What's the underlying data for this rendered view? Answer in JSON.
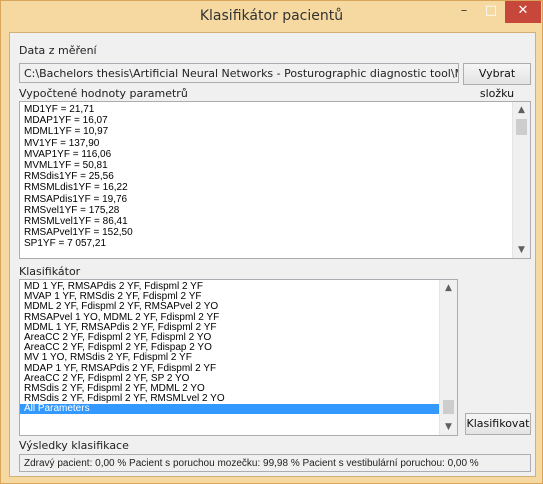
{
  "window": {
    "title": "Klasifikátor pacientů",
    "minimize": "–",
    "maximize": "□",
    "close": "✕"
  },
  "measurement": {
    "label": "Data z měření",
    "path": "C:\\Bachelors thesis\\Artificial Neural Networks - Posturographic diagnostic tool\\Measurements\\Bene",
    "browse_button": "Vybrat složku"
  },
  "parameters": {
    "label": "Vypočtené hodnoty parametrů",
    "lines": [
      "MD1YF = 21,71",
      "MDAP1YF = 16,07",
      "MDML1YF = 10,97",
      "MV1YF = 137,90",
      "MVAP1YF = 116,06",
      "MVML1YF = 50,81",
      "RMSdis1YF = 25,56",
      "RMSMLdis1YF = 16,22",
      "RMSAPdis1YF = 19,76",
      "RMSvel1YF = 175,28",
      "RMSMLvel1YF = 86,41",
      "RMSAPvel1YF = 152,50",
      "SP1YF = 7 057,21"
    ]
  },
  "classifier": {
    "label": "Klasifikátor",
    "items": [
      "MD 1 YF, RMSAPdis 2 YF, Fdispml 2 YF",
      "MVAP 1 YF, RMSdis 2 YF, Fdispml 2 YF",
      "MDML 2 YF, Fdispml 2 YF, RMSAPvel 2 YO",
      "RMSAPvel 1 YO, MDML 2 YF, Fdispml 2 YF",
      "MDML 1 YF, RMSAPdis 2 YF, Fdispml 2 YF",
      "AreaCC 2 YF, Fdispml 2 YF, Fdispml 2 YO",
      "AreaCC 2 YF, Fdispml 2 YF, Fdispap 2 YO",
      "MV 1 YO, RMSdis 2 YF, Fdispml 2 YF",
      "MDAP 1 YF, RMSAPdis 2 YF, Fdispml 2 YF",
      "AreaCC 2 YF, Fdispml 2 YF, SP 2 YO",
      "RMSdis 2 YF, Fdispml 2 YF, MDML 2 YO",
      "RMSdis 2 YF, Fdispml 2 YF, RMSMLvel 2 YO",
      "All Parameters"
    ],
    "selected": "All Parameters",
    "classify_button": "Klasifikovat"
  },
  "results": {
    "label": "Výsledky klasifikace",
    "text": "Zdravý pacient: 0,00 %   Pacient s poruchou mozečku: 99,98 %   Pacient s vestibulární poruchou: 0,00 %"
  },
  "colors": {
    "titlebar": "#f5d9a0",
    "close": "#c7473b",
    "selection": "#3399ff"
  },
  "icons": {
    "scroll_up": "▲",
    "scroll_down": "▼"
  }
}
